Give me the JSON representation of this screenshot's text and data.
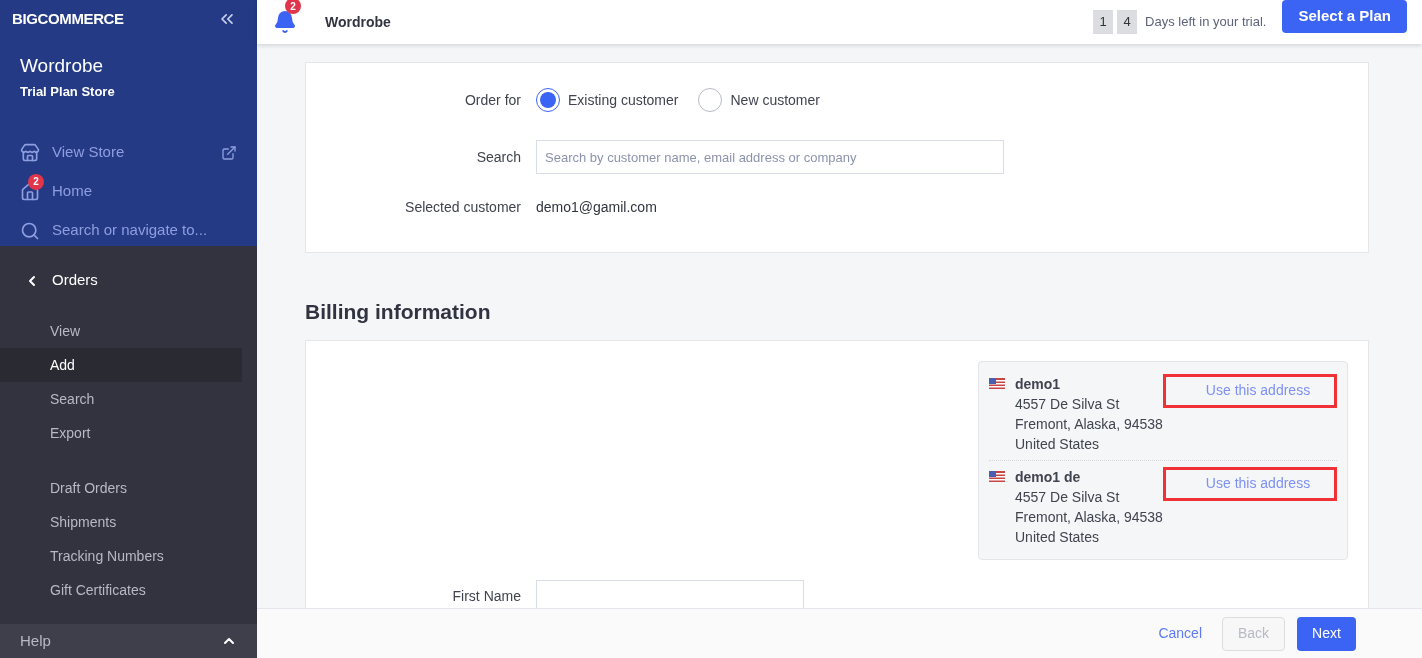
{
  "sidebar": {
    "logo": "BIGCOMMERCE",
    "store": {
      "name": "Wordrobe",
      "plan": "Trial Plan Store"
    },
    "nav": [
      {
        "kind": "store",
        "label": "View Store",
        "external": true
      },
      {
        "kind": "home",
        "label": "Home",
        "badge": "2",
        "external": false
      },
      {
        "kind": "search",
        "label": "Search or navigate to...",
        "external": false
      }
    ],
    "section": {
      "title": "Orders",
      "groups": [
        [
          {
            "label": "View",
            "selected": false
          },
          {
            "label": "Add",
            "selected": true
          },
          {
            "label": "Search",
            "selected": false
          },
          {
            "label": "Export",
            "selected": false
          }
        ],
        [
          {
            "label": "Draft Orders",
            "selected": false
          },
          {
            "label": "Shipments",
            "selected": false
          },
          {
            "label": "Tracking Numbers",
            "selected": false
          },
          {
            "label": "Gift Certificates",
            "selected": false
          }
        ]
      ]
    },
    "help": "Help"
  },
  "header": {
    "notification_badge": "2",
    "title": "Wordrobe",
    "trial_digits": [
      "1",
      "4"
    ],
    "trial_text": "Days left in your trial.",
    "plan_button": "Select a Plan"
  },
  "customer": {
    "order_for_label": "Order for",
    "options": [
      {
        "label": "Existing customer",
        "selected": true
      },
      {
        "label": "New customer",
        "selected": false
      }
    ],
    "search_label": "Search",
    "search_placeholder": "Search by customer name, email address or company",
    "selected_label": "Selected customer",
    "selected_value": "demo1@gamil.com"
  },
  "billing": {
    "heading": "Billing information",
    "addresses": [
      {
        "name": "demo1",
        "lines": [
          "4557 De Silva St",
          "Fremont, Alaska, 94538",
          "United States"
        ],
        "action": "Use this address",
        "highlighted": true
      },
      {
        "name": "demo1 de",
        "lines": [
          "4557 De Silva St",
          "Fremont, Alaska, 94538",
          "United States"
        ],
        "action": "Use this address",
        "highlighted": true
      }
    ],
    "first_name_label": "First Name"
  },
  "footer": {
    "cancel": "Cancel",
    "back": {
      "label": "Back",
      "disabled": true
    },
    "next": "Next"
  }
}
